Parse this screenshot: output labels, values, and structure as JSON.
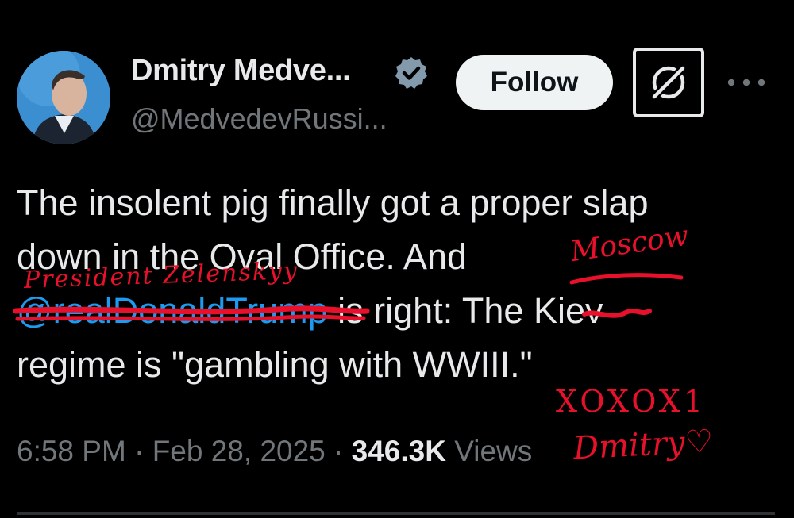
{
  "author": {
    "display_name": "Dmitry Medve...",
    "handle": "@MedvedevRussi...",
    "follow_label": "Follow",
    "verified_icon": "verified-badge-icon"
  },
  "tweet": {
    "line1": "The insolent pig finally got a proper slap",
    "line2": "down in the Oval Office. And",
    "mention": "@realDonaldTrump",
    "line3_rest": " is right: The Kiev",
    "line4": "regime is \"gambling with WWIII.\""
  },
  "meta": {
    "time": "6:58 PM",
    "sep1": " · ",
    "date": "Feb 28, 2025",
    "sep2": " · ",
    "views_count": "346.3K",
    "views_label": " Views"
  },
  "annotations": {
    "replacement_mention": "President Zelenskyy",
    "replacement_city": "Moscow",
    "kisses": "XOXOX1",
    "signature": "Dmitry♡"
  },
  "colors": {
    "background": "#000000",
    "text": "#e7e9ea",
    "muted": "#71767b",
    "link": "#1d9bf0",
    "ink": "#e8102a"
  }
}
